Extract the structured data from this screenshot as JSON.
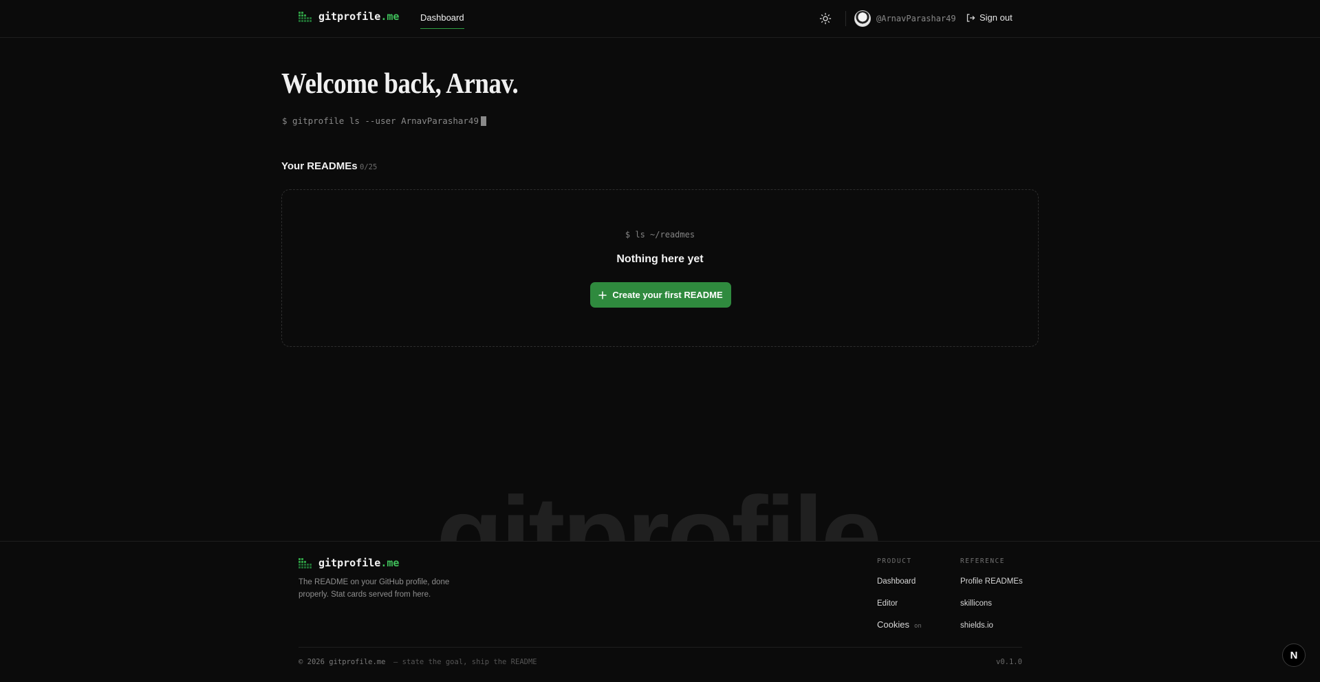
{
  "header": {
    "brand_name": "gitprofile",
    "brand_suffix": ".me",
    "nav_dashboard": "Dashboard",
    "username": "@ArnavParashar49",
    "signout_label": "Sign out"
  },
  "main": {
    "welcome": "Welcome back, Arnav.",
    "command": "$ gitprofile ls --user ArnavParashar49",
    "section_title": "Your READMEs",
    "count": "0/25",
    "empty_command": "$ ls ~/readmes",
    "empty_title": "Nothing here yet",
    "create_button": "Create your first README"
  },
  "watermark": "gitprofile",
  "footer": {
    "brand_name": "gitprofile",
    "brand_suffix": ".me",
    "tagline": "The README on your GitHub profile, done properly. Stat cards served from here.",
    "product_title": "PRODUCT",
    "product_links": [
      "Dashboard",
      "Editor",
      "Cookies"
    ],
    "cookies_state": "on",
    "reference_title": "REFERENCE",
    "reference_links": [
      "Profile READMEs",
      "skillicons",
      "shields.io"
    ],
    "copyright": "© 2026 gitprofile.me",
    "slogan": "— state the goal, ship the README",
    "version": "v0.1.0"
  },
  "badge": "N",
  "colors": {
    "accent": "#2ea043",
    "button": "#2f8a3e",
    "background": "#0b0b0b"
  },
  "icons": [
    "grid-logo-icon",
    "sun-icon",
    "sign-out-icon",
    "plus-icon"
  ]
}
